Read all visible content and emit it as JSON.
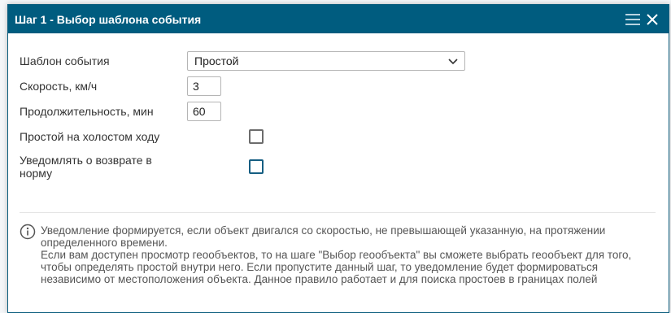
{
  "dialog": {
    "title": "Шаг 1 - Выбор шаблона события"
  },
  "form": {
    "template": {
      "label": "Шаблон события",
      "value": "Простой"
    },
    "speed": {
      "label": "Скорость, км/ч",
      "value": "3"
    },
    "duration": {
      "label": "Продолжительность, мин",
      "value": "60"
    },
    "idle": {
      "label": "Простой на холостом ходу",
      "checked": false
    },
    "notify_return": {
      "label": "Уведомлять о возврате в норму",
      "checked": false
    }
  },
  "info": {
    "line1": "Уведомление формируется, если объект двигался со скоростью, не превышающей указанную, на протяжении",
    "line2": "определенного времени.",
    "line3": "Если вам доступен просмотр геообъектов, то на шаге \"Выбор геообъекта\" вы сможете выбрать геообъект для того,",
    "line4": "чтобы определять простой внутри него. Если пропустите данный шаг, то уведомление будет формироваться",
    "line5": "независимо от местоположения объекта. Данное правило работает и для поиска простоев в границах полей"
  },
  "colors": {
    "titlebar": "#005c7f",
    "checkbox_accent": "#155e82"
  },
  "icons": [
    "menu-icon",
    "close-icon",
    "chevron-down-icon",
    "info-icon"
  ]
}
